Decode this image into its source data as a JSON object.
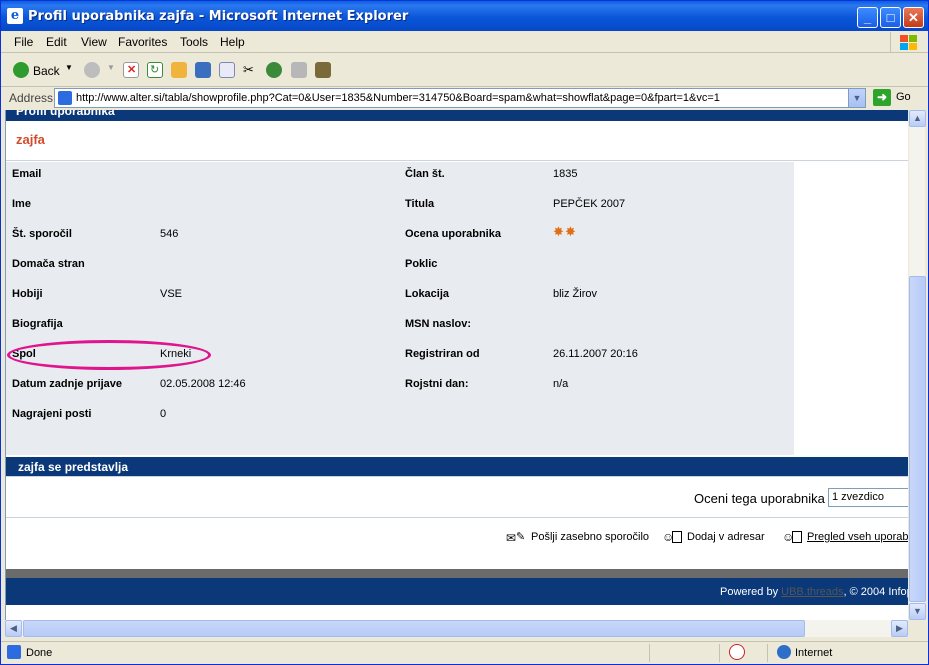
{
  "window": {
    "title": "Profil uporabnika zajfa - Microsoft Internet Explorer",
    "min_glyph": "_",
    "max_glyph": "□",
    "close_glyph": "✕"
  },
  "menu": [
    "File",
    "Edit",
    "View",
    "Favorites",
    "Tools",
    "Help"
  ],
  "toolbar": {
    "back_label": "Back"
  },
  "address": {
    "label": "Address",
    "url": "http://www.alter.si/tabla/showprofile.php?Cat=0&User=1835&Number=314750&Board=spam&what=showflat&page=0&fpart=1&vc=1",
    "go_label": "Go"
  },
  "page": {
    "header": "Profil uporabnika",
    "username": "zajfa",
    "left_fields": [
      {
        "label": "Email",
        "value": ""
      },
      {
        "label": "Ime",
        "value": ""
      },
      {
        "label": "Št. sporočil",
        "value": "546"
      },
      {
        "label": "Domača stran",
        "value": ""
      },
      {
        "label": "Hobiji",
        "value": "VSE"
      },
      {
        "label": "Biografija",
        "value": ""
      },
      {
        "label": "Spol",
        "value": "Krneki"
      },
      {
        "label": "Datum zadnje prijave",
        "value": "02.05.2008 12:46"
      },
      {
        "label": "Nagrajeni posti",
        "value": "0"
      }
    ],
    "right_fields": [
      {
        "label": "Član št.",
        "value": "1835"
      },
      {
        "label": "Titula",
        "value": "PEPČEK 2007"
      },
      {
        "label": "Ocena uporabnika",
        "value": ""
      },
      {
        "label": "Poklic",
        "value": ""
      },
      {
        "label": "Lokacija",
        "value": "bliz Žirov"
      },
      {
        "label": "MSN naslov:",
        "value": ""
      },
      {
        "label": "Registriran od",
        "value": "26.11.2007 20:16"
      },
      {
        "label": "Rojstni dan:",
        "value": "n/a"
      }
    ],
    "rating_stars": 2,
    "section_title": "zajfa se predstavlja",
    "rate_label": "Oceni tega uporabnika",
    "rate_value": "1 zvezdico",
    "actions": {
      "send_pm": "Pošlji zasebno sporočilo",
      "add_address": "Dodaj v adresar",
      "view_posts": "Pregled vseh uporab"
    },
    "footer": {
      "powered_by": "Powered by",
      "product": "UBB.threads",
      "copyright": ", © 2004 Infop"
    }
  },
  "status": {
    "left": "Done",
    "zone": "Internet"
  }
}
